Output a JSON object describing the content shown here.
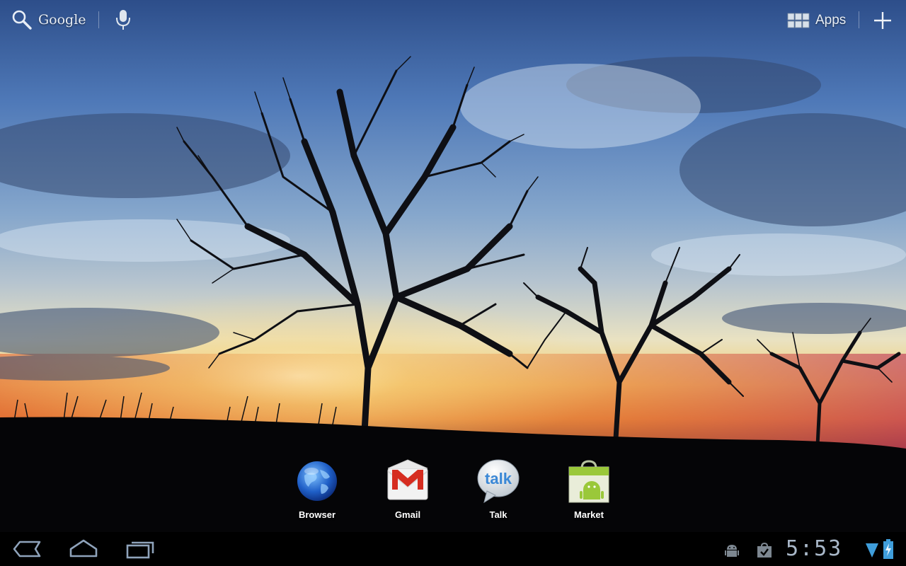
{
  "top_bar": {
    "search_label": "Google",
    "search_icon": "search-icon",
    "voice_icon": "microphone-icon",
    "apps_label": "Apps",
    "apps_icon": "grid-icon",
    "add_icon": "plus-icon"
  },
  "dock": {
    "items": [
      {
        "label": "Browser",
        "icon": "globe-icon"
      },
      {
        "label": "Gmail",
        "icon": "gmail-envelope-icon"
      },
      {
        "label": "Talk",
        "icon": "talk-bubble-icon"
      },
      {
        "label": "Market",
        "icon": "market-bag-icon"
      }
    ]
  },
  "system_bar": {
    "nav": [
      "back-icon",
      "home-icon",
      "recent-apps-icon"
    ],
    "status_icons": [
      "android-debug-icon",
      "market-notification-icon",
      "wifi-icon",
      "battery-charging-icon"
    ],
    "clock": "5:53"
  },
  "colors": {
    "accent": "#3f9edb",
    "clock": "#a9b8c9",
    "gmail_red": "#d62d20",
    "android_green": "#9ac83a"
  }
}
